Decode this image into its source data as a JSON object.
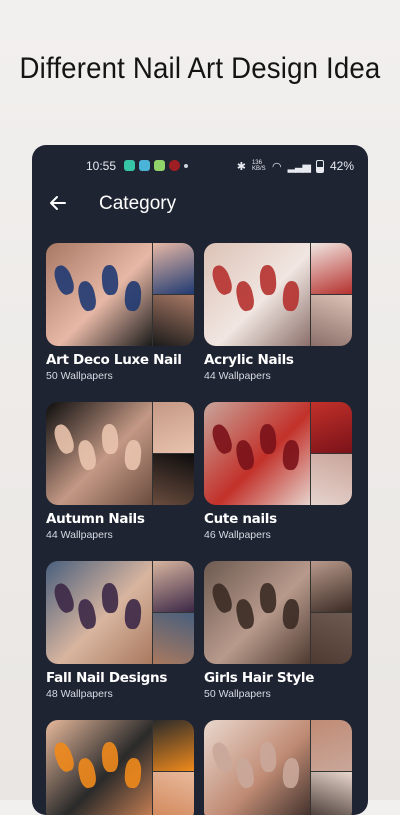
{
  "headline": "Different Nail Art Design Idea",
  "status_bar": {
    "time": "10:55",
    "battery": "42%",
    "net_speed": "136 KB/S"
  },
  "app_bar": {
    "back_icon": "arrow-left-icon",
    "title": "Category"
  },
  "categories": [
    {
      "name": "Art Deco Luxe Nail",
      "count": "50 Wallpapers",
      "colors": [
        "#a77864",
        "#203a72",
        "#e7b8a5",
        "#1b1b1b"
      ]
    },
    {
      "name": "Acrylic Nails",
      "count": "44 Wallpapers",
      "colors": [
        "#dcc2b6",
        "#b5312e",
        "#f1e6e1",
        "#8b6f6a"
      ]
    },
    {
      "name": "Autumn Nails",
      "count": "44 Wallpapers",
      "colors": [
        "#0d0d0d",
        "#e9c3ad",
        "#c49985",
        "#6a4c3e"
      ]
    },
    {
      "name": "Cute nails",
      "count": "46 Wallpapers",
      "colors": [
        "#c9a59b",
        "#7a1219",
        "#c2312a",
        "#e6d3cc"
      ]
    },
    {
      "name": "Fall Nail Designs",
      "count": "48 Wallpapers",
      "colors": [
        "#495f7d",
        "#3c2847",
        "#d8b59f",
        "#a9795f"
      ]
    },
    {
      "name": "Girls Hair Style",
      "count": "50 Wallpapers",
      "colors": [
        "#6d5a50",
        "#3b2b24",
        "#b89a8c",
        "#4e3a30"
      ]
    },
    {
      "name": "",
      "count": "",
      "colors": [
        "#e8b99c",
        "#f08a1c",
        "#2a2a2a",
        "#d08455"
      ]
    },
    {
      "name": "",
      "count": "",
      "colors": [
        "#e9d7cd",
        "#c9a79a",
        "#c08b74",
        "#3a2c28"
      ]
    }
  ]
}
